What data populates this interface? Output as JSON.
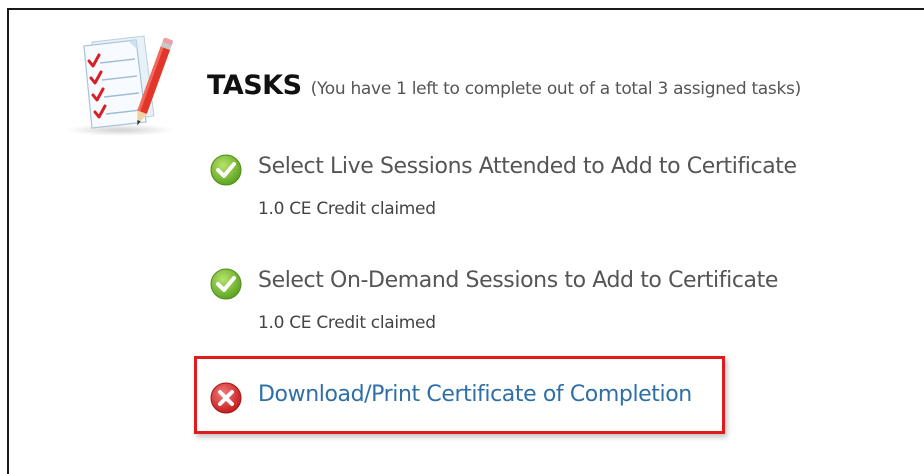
{
  "header": {
    "title": "TASKS",
    "subtitle": "(You have 1 left to complete out of a total 3 assigned tasks)"
  },
  "tasks": [
    {
      "title": "Select Live Sessions Attended to Add to Certificate",
      "credit": "1.0 CE Credit claimed",
      "status": "complete",
      "icon": "check-circle-icon"
    },
    {
      "title": "Select On-Demand Sessions to Add to Certificate",
      "credit": "1.0 CE Credit claimed",
      "status": "complete",
      "icon": "check-circle-icon"
    },
    {
      "title": "Download/Print Certificate of Completion",
      "status": "incomplete",
      "icon": "x-circle-icon"
    }
  ],
  "colors": {
    "link": "#2f6fa8",
    "complete_green": "#6fb52c",
    "incomplete_red": "#d62b2b",
    "highlight_border": "#e01b1b"
  }
}
